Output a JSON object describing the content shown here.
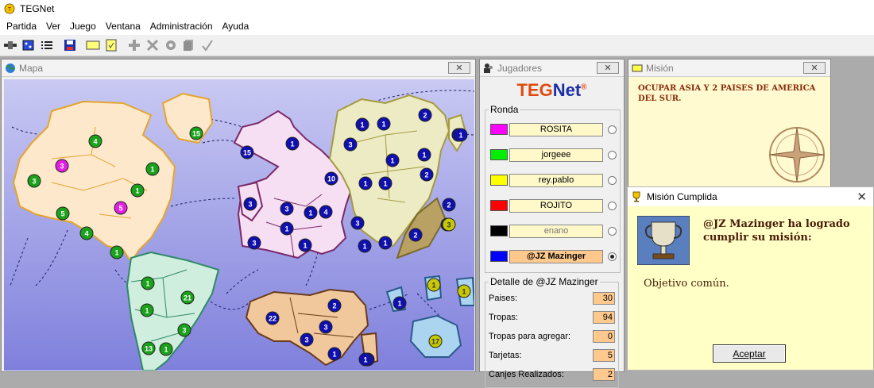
{
  "app": {
    "title": "TEGNet"
  },
  "menu": [
    "Partida",
    "Ver",
    "Juego",
    "Ventana",
    "Administración",
    "Ayuda"
  ],
  "map_window": {
    "title": "Mapa",
    "close": "✕",
    "countries": [
      {
        "n": "4",
        "c": "#1aa21a"
      },
      {
        "n": "3",
        "c": "#e21fe2"
      },
      {
        "n": "3",
        "c": "#1aa21a"
      },
      {
        "n": "1",
        "c": "#1aa21a"
      },
      {
        "n": "1",
        "c": "#1aa21a"
      },
      {
        "n": "5",
        "c": "#1aa21a"
      },
      {
        "n": "5",
        "c": "#e21fe2"
      },
      {
        "n": "4",
        "c": "#1aa21a"
      },
      {
        "n": "1",
        "c": "#1aa21a"
      },
      {
        "n": "15",
        "c": "#1aa21a"
      },
      {
        "n": "15",
        "c": "#1010b0"
      },
      {
        "n": "1",
        "c": "#1010b0"
      },
      {
        "n": "3",
        "c": "#1010b0"
      },
      {
        "n": "10",
        "c": "#1010b0"
      },
      {
        "n": "1",
        "c": "#1010b0"
      },
      {
        "n": "1",
        "c": "#1010b0"
      },
      {
        "n": "1",
        "c": "#1010b0"
      },
      {
        "n": "3",
        "c": "#1010b0"
      },
      {
        "n": "3",
        "c": "#1010b0"
      },
      {
        "n": "1",
        "c": "#1010b0"
      },
      {
        "n": "1",
        "c": "#1010b0"
      },
      {
        "n": "4",
        "c": "#1010b0"
      },
      {
        "n": "1",
        "c": "#1010b0"
      },
      {
        "n": "1",
        "c": "#1010b0"
      },
      {
        "n": "3",
        "c": "#1010b0"
      },
      {
        "n": "1",
        "c": "#1010b0"
      },
      {
        "n": "3",
        "c": "#1010b0"
      },
      {
        "n": "1",
        "c": "#1010b0"
      },
      {
        "n": "1",
        "c": "#1010b0"
      },
      {
        "n": "2",
        "c": "#1010b0"
      },
      {
        "n": "1",
        "c": "#1010b0"
      },
      {
        "n": "1",
        "c": "#1010b0"
      },
      {
        "n": "2",
        "c": "#1010b0"
      },
      {
        "n": "2",
        "c": "#1010b0"
      },
      {
        "n": "1",
        "c": "#1010b0"
      },
      {
        "n": "2",
        "c": "#1010b0"
      },
      {
        "n": "1",
        "c": "#1010b0"
      },
      {
        "n": "1",
        "c": "#1010b0"
      },
      {
        "n": "3",
        "c": "#c8c800"
      },
      {
        "n": "1",
        "c": "#1aa21a"
      },
      {
        "n": "21",
        "c": "#1aa21a"
      },
      {
        "n": "1",
        "c": "#1aa21a"
      },
      {
        "n": "3",
        "c": "#1aa21a"
      },
      {
        "n": "13",
        "c": "#1aa21a"
      },
      {
        "n": "1",
        "c": "#1aa21a"
      },
      {
        "n": "22",
        "c": "#1010b0"
      },
      {
        "n": "2",
        "c": "#1010b0"
      },
      {
        "n": "3",
        "c": "#1010b0"
      },
      {
        "n": "3",
        "c": "#1010b0"
      },
      {
        "n": "1",
        "c": "#1010b0"
      },
      {
        "n": "1",
        "c": "#1010b0"
      },
      {
        "n": "1",
        "c": "#1010b0"
      },
      {
        "n": "1",
        "c": "#c8c800"
      },
      {
        "n": "1",
        "c": "#c8c800"
      },
      {
        "n": "17",
        "c": "#c8c800"
      },
      {
        "n": "1",
        "c": "#1010b0"
      }
    ]
  },
  "players_window": {
    "title": "Jugadores",
    "close": "✕",
    "logo_a": "TEG",
    "logo_b": "Net",
    "logo_mark": "®",
    "round_label": "Ronda",
    "players": [
      {
        "name": "ROSITA",
        "color": "#ff00ff",
        "active": false
      },
      {
        "name": "jorgeee",
        "color": "#00ee00",
        "active": false
      },
      {
        "name": "rey.pablo",
        "color": "#ffff00",
        "active": false
      },
      {
        "name": "ROJITO",
        "color": "#ff0000",
        "active": false
      },
      {
        "name": "enano",
        "color": "#000000",
        "active": false
      },
      {
        "name": "@JZ Mazinger",
        "color": "#0000ff",
        "active": true
      }
    ],
    "detail_label": "Detalle de @JZ Mazinger",
    "details": [
      {
        "label": "Paises:",
        "value": "30"
      },
      {
        "label": "Tropas:",
        "value": "94"
      },
      {
        "label": "Tropas para agregar:",
        "value": "0"
      },
      {
        "label": "Tarjetas:",
        "value": "5"
      },
      {
        "label": "Canjes Realizados:",
        "value": "2"
      }
    ]
  },
  "mission_window": {
    "title": "Misión",
    "close": "✕",
    "text": "OCUPAR ASIA Y 2 PAISES DE AMERICA DEL SUR."
  },
  "dialog": {
    "title": "Misión Cumplida",
    "close": "✕",
    "message": "@JZ Mazinger ha logrado cumplir su misión:",
    "objective": "Objetivo común.",
    "button": "Aceptar"
  }
}
